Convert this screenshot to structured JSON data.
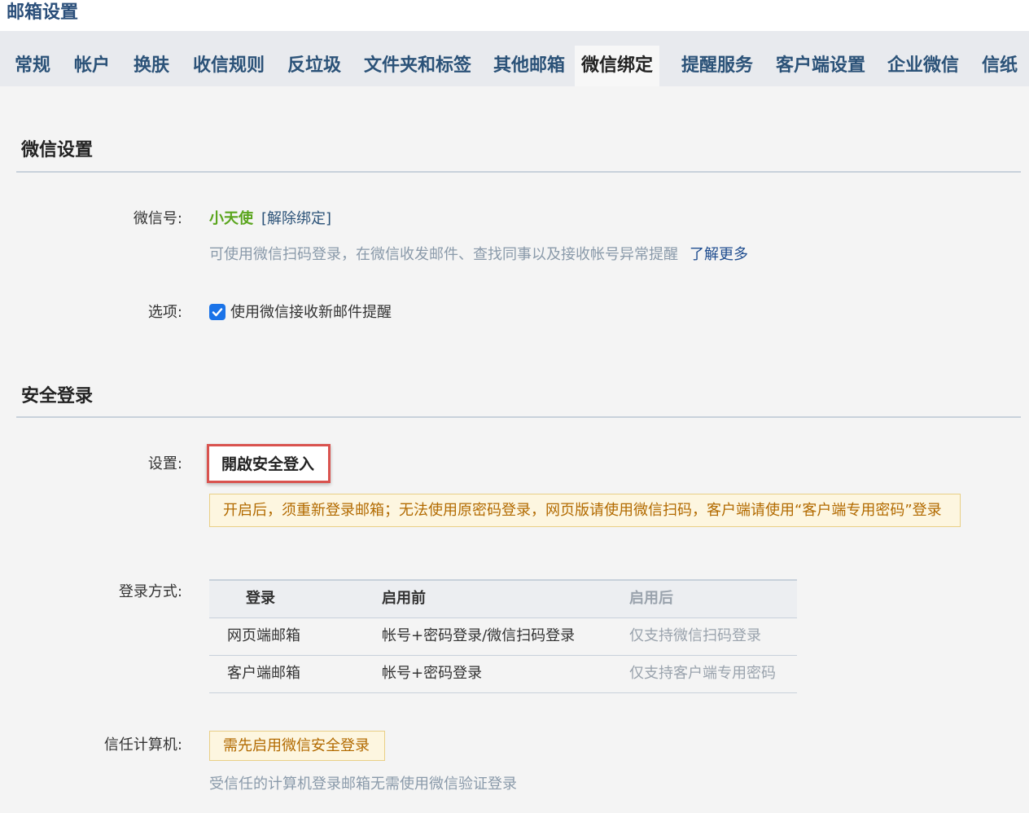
{
  "app": {
    "title": "邮箱设置"
  },
  "tabs": [
    {
      "label": "常规"
    },
    {
      "label": "帐户"
    },
    {
      "label": "换肤"
    },
    {
      "label": "收信规则"
    },
    {
      "label": "反垃圾"
    },
    {
      "label": "文件夹和标签"
    },
    {
      "label": "其他邮箱"
    },
    {
      "label": "微信绑定",
      "active": true
    },
    {
      "label": "提醒服务"
    },
    {
      "label": "客户端设置"
    },
    {
      "label": "企业微信"
    },
    {
      "label": "信纸"
    }
  ],
  "wechat_settings": {
    "title": "微信设置",
    "wechat_id_label": "微信号:",
    "wechat_id_value": "小天使",
    "unbind_link": "[解除绑定]",
    "description": "可使用微信扫码登录，在微信收发邮件、查找同事以及接收帐号异常提醒",
    "learn_more": "了解更多",
    "options_label": "选项:",
    "option_new_mail": "使用微信接收新邮件提醒",
    "option_new_mail_checked": true
  },
  "secure_login": {
    "title": "安全登录",
    "settings_label": "设置:",
    "enable_button": "開啟安全登入",
    "warning": "开启后，须重新登录邮箱；无法使用原密码登录，网页版请使用微信扫码，客户端请使用“客户端专用密码”登录",
    "login_method_label": "登录方式:",
    "table": {
      "headers": [
        "登录",
        "启用前",
        "启用后"
      ],
      "rows": [
        [
          "网页端邮箱",
          "帐号+密码登录/微信扫码登录",
          "仅支持微信扫码登录"
        ],
        [
          "客户端邮箱",
          "帐号+密码登录",
          "仅支持客户端专用密码"
        ]
      ]
    },
    "trusted_label": "信任计算机:",
    "trusted_notice": "需先启用微信安全登录",
    "trusted_hint": "受信任的计算机登录邮箱无需使用微信验证登录"
  },
  "colors": {
    "tab_text": "#2b5278",
    "wechat_id": "#5aa51d",
    "checkbox": "#1a73e8",
    "highlight_border": "#d9534f",
    "warning_bg": "#fdf6e0",
    "warning_text": "#b26a00"
  }
}
